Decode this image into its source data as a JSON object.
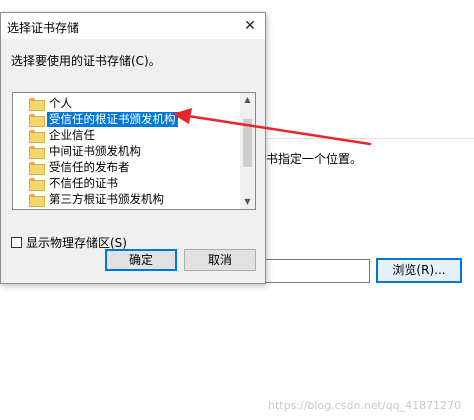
{
  "background": {
    "hint_text": "书指定一个位置。",
    "browse_label": "浏览(R)...",
    "watermark": "https://blog.csdn.net/qq_41871270"
  },
  "dialog": {
    "title": "选择证书存储",
    "close_glyph": "✕",
    "prompt": "选择要使用的证书存储(C)。",
    "stores": [
      {
        "label": "个人",
        "selected": false
      },
      {
        "label": "受信任的根证书颁发机构",
        "selected": true
      },
      {
        "label": "企业信任",
        "selected": false
      },
      {
        "label": "中间证书颁发机构",
        "selected": false
      },
      {
        "label": "受信任的发布者",
        "selected": false
      },
      {
        "label": "不信任的证书",
        "selected": false
      },
      {
        "label": "第三方根证书颁发机构",
        "selected": false
      }
    ],
    "show_physical_label": "显示物理存储区(S)",
    "show_physical_checked": false,
    "ok_label": "确定",
    "cancel_label": "取消"
  },
  "annotation": {
    "arrow_color": "#e8262b"
  },
  "colors": {
    "selection": "#0078d7",
    "folder": "#f6d46e"
  }
}
